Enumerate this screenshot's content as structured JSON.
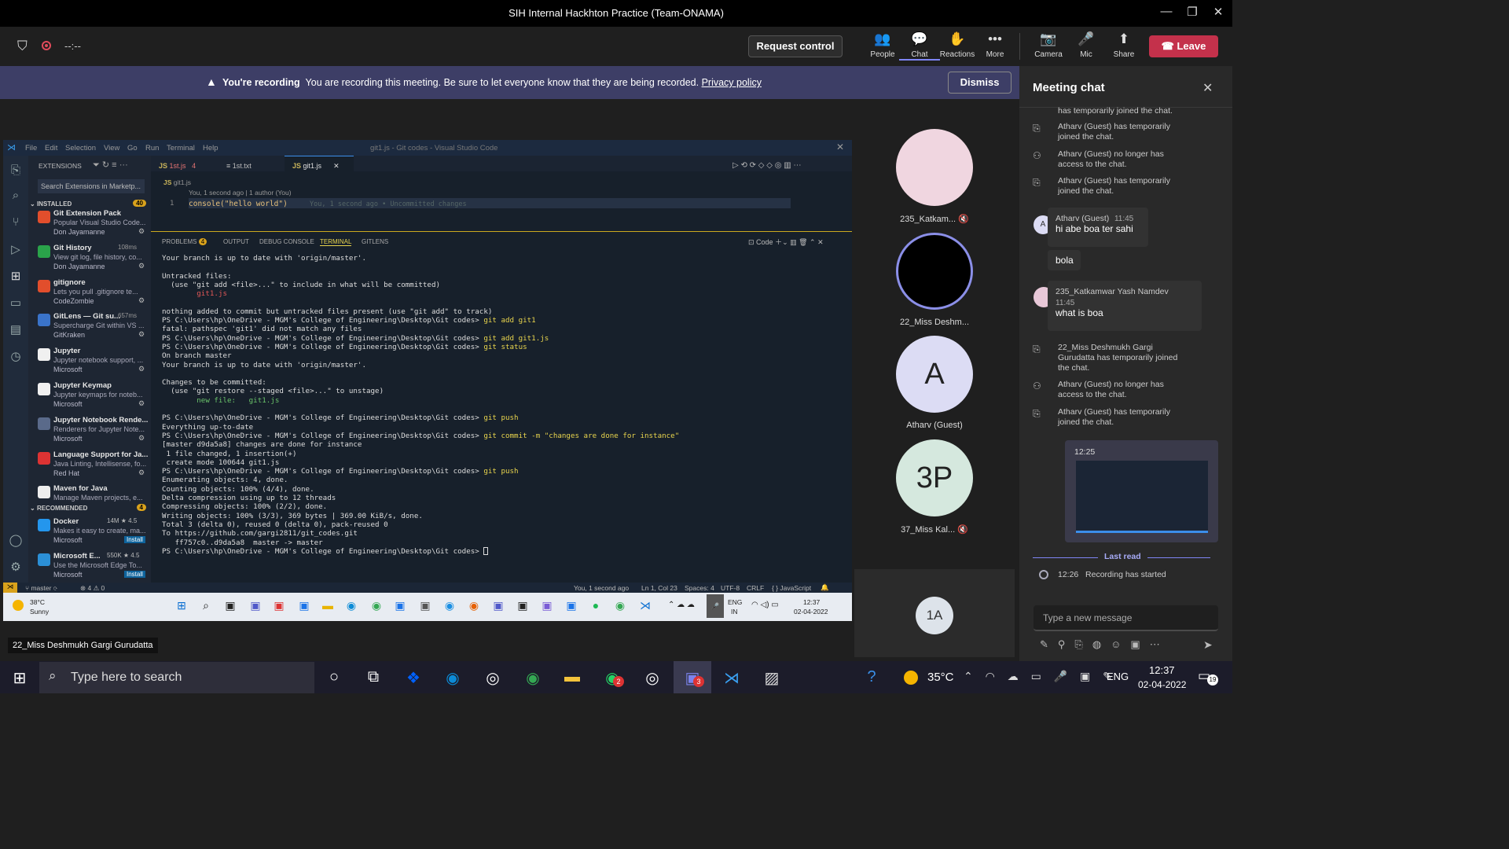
{
  "window": {
    "title": "SIH Internal Hackhton Practice (Team-ONAMA)"
  },
  "toolbar": {
    "timer": "--:--",
    "request_control": "Request control",
    "buttons": [
      {
        "label": "People",
        "icon": "people-icon"
      },
      {
        "label": "Chat",
        "icon": "chat-icon"
      },
      {
        "label": "Reactions",
        "icon": "reactions-icon"
      },
      {
        "label": "More",
        "icon": "more-icon"
      },
      {
        "label": "Camera",
        "icon": "camera-off-icon"
      },
      {
        "label": "Mic",
        "icon": "mic-icon"
      },
      {
        "label": "Share",
        "icon": "share-icon"
      }
    ],
    "leave": "Leave"
  },
  "banner": {
    "strong": "You're recording",
    "text": "You are recording this meeting. Be sure to let everyone know that they are being recorded.",
    "link": "Privacy policy",
    "dismiss": "Dismiss"
  },
  "vscode": {
    "menu": [
      "File",
      "Edit",
      "Selection",
      "View",
      "Go",
      "Run",
      "Terminal",
      "Help"
    ],
    "title": "git1.js - Git codes - Visual Studio Code",
    "sidebar": {
      "header": "EXTENSIONS",
      "search_placeholder": "Search Extensions in Marketp...",
      "installed_label": "INSTALLED",
      "installed_count": "40",
      "recommended_label": "RECOMMENDED",
      "recommended_count": "4",
      "items": [
        {
          "name": "Git Extension Pack",
          "desc": "Popular Visual Studio Code...",
          "publisher": "Don Jayamanne",
          "color": "#e24e2c"
        },
        {
          "name": "Git History",
          "desc": "View git log, file history, co...",
          "publisher": "Don Jayamanne",
          "color": "#2aa34a",
          "meta": "108ms"
        },
        {
          "name": "gitignore",
          "desc": "Lets you pull .gitignore te...",
          "publisher": "CodeZombie",
          "color": "#e24e2c"
        },
        {
          "name": "GitLens — Git su...",
          "desc": "Supercharge Git within VS ...",
          "publisher": "GitKraken",
          "color": "#3a73c9",
          "meta": "657ms"
        },
        {
          "name": "Jupyter",
          "desc": "Jupyter notebook support, ...",
          "publisher": "Microsoft",
          "color": "#f0f0f0"
        },
        {
          "name": "Jupyter Keymap",
          "desc": "Jupyter keymaps for noteb...",
          "publisher": "Microsoft",
          "color": "#f0f0f0"
        },
        {
          "name": "Jupyter Notebook Rende...",
          "desc": "Renderers for Jupyter Note...",
          "publisher": "Microsoft",
          "color": "#5a6a8a"
        },
        {
          "name": "Language Support for Ja...",
          "desc": "Java Linting, Intellisense, fo...",
          "publisher": "Red Hat",
          "color": "#d33"
        },
        {
          "name": "Maven for Java",
          "desc": "Manage Maven projects, e...",
          "publisher": "",
          "color": "#eee"
        }
      ],
      "recommended": [
        {
          "name": "Docker",
          "desc": "Makes it easy to create, ma...",
          "publisher": "Microsoft",
          "meta": "14M ★ 4.5",
          "install": "Install",
          "color": "#2496ed"
        },
        {
          "name": "Microsoft E...",
          "desc": "Use the Microsoft Edge To...",
          "publisher": "Microsoft",
          "meta": "550K ★ 4.5",
          "install": "Install",
          "color": "#2b8fd6"
        }
      ]
    },
    "tabs": [
      {
        "label": "1st.js",
        "badge": "4"
      },
      {
        "label": "1st.txt"
      },
      {
        "label": "git1.js"
      }
    ],
    "breadcrumb": "git1.js",
    "codelens": "You, 1 second ago | 1 author (You)",
    "line_no": "1",
    "code": "console(\"hello world\")",
    "blame": "You, 1 second ago • Uncommitted changes",
    "panel_tabs": [
      "PROBLEMS",
      "OUTPUT",
      "DEBUG CONSOLE",
      "TERMINAL",
      "GITLENS"
    ],
    "problems_count": "4",
    "panel_right": "Code",
    "terminal_lines": [
      "Your branch is up to date with 'origin/master'.",
      "",
      "Untracked files:",
      "  (use \"git add <file>...\" to include in what will be committed)",
      "        git1.js",
      "",
      "nothing added to commit but untracked files present (use \"git add\" to track)",
      "PS C:\\Users\\hp\\OneDrive - MGM's College of Engineering\\Desktop\\Git codes> git add git1",
      "fatal: pathspec 'git1' did not match any files",
      "PS C:\\Users\\hp\\OneDrive - MGM's College of Engineering\\Desktop\\Git codes> git add git1.js",
      "PS C:\\Users\\hp\\OneDrive - MGM's College of Engineering\\Desktop\\Git codes> git status",
      "On branch master",
      "Your branch is up to date with 'origin/master'.",
      "",
      "Changes to be committed:",
      "  (use \"git restore --staged <file>...\" to unstage)",
      "        new file:   git1.js",
      "",
      "PS C:\\Users\\hp\\OneDrive - MGM's College of Engineering\\Desktop\\Git codes> git push",
      "Everything up-to-date",
      "PS C:\\Users\\hp\\OneDrive - MGM's College of Engineering\\Desktop\\Git codes> git commit -m \"changes are done for instance\"",
      "[master d9da5a8] changes are done for instance",
      " 1 file changed, 1 insertion(+)",
      " create mode 100644 git1.js",
      "PS C:\\Users\\hp\\OneDrive - MGM's College of Engineering\\Desktop\\Git codes> git push",
      "Enumerating objects: 4, done.",
      "Counting objects: 100% (4/4), done.",
      "Delta compression using up to 12 threads",
      "Compressing objects: 100% (2/2), done.",
      "Writing objects: 100% (3/3), 369 bytes | 369.00 KiB/s, done.",
      "Total 3 (delta 0), reused 0 (delta 0), pack-reused 0",
      "To https://github.com/gargi2811/git_codes.git",
      "   ff757c0..d9da5a8  master -> master",
      "PS C:\\Users\\hp\\OneDrive - MGM's College of Engineering\\Desktop\\Git codes> "
    ],
    "status": {
      "branch": "master",
      "problems": "⊗ 4 ⚠ 0",
      "blame": "You, 1 second ago",
      "pos": "Ln 1, Col 23",
      "spaces": "Spaces: 4",
      "enc": "UTF-8",
      "eol": "CRLF",
      "lang": "{ } JavaScript"
    }
  },
  "inner_taskbar": {
    "weather_temp": "38°C",
    "weather_desc": "Sunny",
    "lang": "ENG",
    "region": "IN",
    "time": "12:37",
    "date": "02-04-2022"
  },
  "participants": [
    {
      "name": "235_Katkam...",
      "muted": true,
      "color": "#f0d6e0",
      "initials": ""
    },
    {
      "name": "22_Miss Deshm...",
      "muted": false,
      "color": "#000",
      "initials": ""
    },
    {
      "name": "Atharv (Guest)",
      "muted": false,
      "color": "#dcdcf4",
      "initials": "A"
    },
    {
      "name": "37_Miss Kal...",
      "muted": true,
      "color": "#d5e8de",
      "initials": "3P"
    }
  ],
  "self": {
    "initials": "1A"
  },
  "speaker_badge": "22_Miss Deshmukh Gargi Gurudatta",
  "chat": {
    "title": "Meeting chat",
    "first_line": "has temporarily joined the chat.",
    "events1": [
      "Atharv (Guest) has temporarily joined the chat.",
      "Atharv (Guest) no longer has access to the chat.",
      "Atharv (Guest) has temporarily joined the chat."
    ],
    "msg1": {
      "sender": "Atharv (Guest)",
      "time": "11:45",
      "text1": "hi  abe boa ter sahi",
      "text2": "bola",
      "avatar": "A"
    },
    "msg2": {
      "sender": "235_Katkamwar Yash Namdev",
      "time": "11:45",
      "text": "what is boa"
    },
    "events2": [
      "22_Miss Deshmukh Gargi Gurudatta has temporarily joined the chat.",
      "Atharv (Guest) no longer has access to the chat.",
      "Atharv (Guest) has temporarily joined the chat."
    ],
    "screenshot_time": "12:25",
    "last_read": "Last read",
    "recording_time": "12:26",
    "recording_text": "Recording has started",
    "composer_placeholder": "Type a new message"
  },
  "os_taskbar": {
    "search_placeholder": "Type here to search",
    "temp": "35°C",
    "lang": "ENG",
    "time": "12:37",
    "date": "02-04-2022",
    "notif": "19",
    "whatsapp_badge": "2",
    "teams_badge": "3"
  }
}
